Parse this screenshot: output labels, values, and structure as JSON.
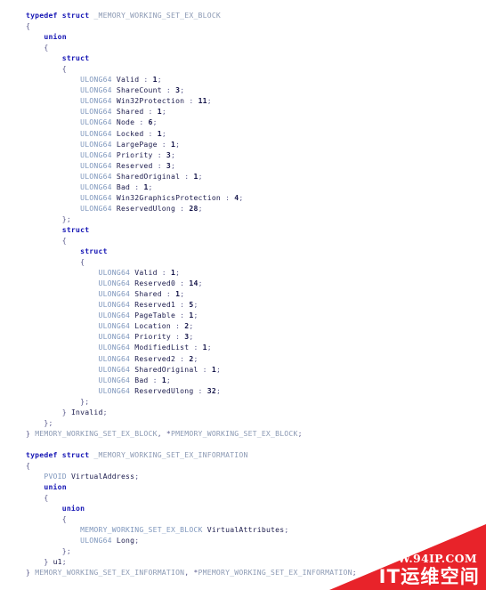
{
  "code": {
    "language": "c",
    "lines": [
      [
        {
          "t": "typedef struct ",
          "c": "kw"
        },
        {
          "t": "_MEMORY_WORKING_SET_EX_BLOCK",
          "c": "tname"
        }
      ],
      [
        {
          "t": "{",
          "c": "punc"
        }
      ],
      [
        {
          "t": "    ",
          "c": "punc"
        },
        {
          "t": "union",
          "c": "kw"
        }
      ],
      [
        {
          "t": "    {",
          "c": "punc"
        }
      ],
      [
        {
          "t": "        ",
          "c": "punc"
        },
        {
          "t": "struct",
          "c": "kw"
        }
      ],
      [
        {
          "t": "        {",
          "c": "punc"
        }
      ],
      [
        {
          "t": "            ",
          "c": "punc"
        },
        {
          "t": "ULONG64",
          "c": "type"
        },
        {
          "t": " ",
          "c": "punc"
        },
        {
          "t": "Valid",
          "c": "ident"
        },
        {
          "t": " : ",
          "c": "punc"
        },
        {
          "t": "1",
          "c": "num"
        },
        {
          "t": ";",
          "c": "punc"
        }
      ],
      [
        {
          "t": "            ",
          "c": "punc"
        },
        {
          "t": "ULONG64",
          "c": "type"
        },
        {
          "t": " ",
          "c": "punc"
        },
        {
          "t": "ShareCount",
          "c": "ident"
        },
        {
          "t": " : ",
          "c": "punc"
        },
        {
          "t": "3",
          "c": "num"
        },
        {
          "t": ";",
          "c": "punc"
        }
      ],
      [
        {
          "t": "            ",
          "c": "punc"
        },
        {
          "t": "ULONG64",
          "c": "type"
        },
        {
          "t": " ",
          "c": "punc"
        },
        {
          "t": "Win32Protection",
          "c": "ident"
        },
        {
          "t": " : ",
          "c": "punc"
        },
        {
          "t": "11",
          "c": "num"
        },
        {
          "t": ";",
          "c": "punc"
        }
      ],
      [
        {
          "t": "            ",
          "c": "punc"
        },
        {
          "t": "ULONG64",
          "c": "type"
        },
        {
          "t": " ",
          "c": "punc"
        },
        {
          "t": "Shared",
          "c": "ident"
        },
        {
          "t": " : ",
          "c": "punc"
        },
        {
          "t": "1",
          "c": "num"
        },
        {
          "t": ";",
          "c": "punc"
        }
      ],
      [
        {
          "t": "            ",
          "c": "punc"
        },
        {
          "t": "ULONG64",
          "c": "type"
        },
        {
          "t": " ",
          "c": "punc"
        },
        {
          "t": "Node",
          "c": "ident"
        },
        {
          "t": " : ",
          "c": "punc"
        },
        {
          "t": "6",
          "c": "num"
        },
        {
          "t": ";",
          "c": "punc"
        }
      ],
      [
        {
          "t": "            ",
          "c": "punc"
        },
        {
          "t": "ULONG64",
          "c": "type"
        },
        {
          "t": " ",
          "c": "punc"
        },
        {
          "t": "Locked",
          "c": "ident"
        },
        {
          "t": " : ",
          "c": "punc"
        },
        {
          "t": "1",
          "c": "num"
        },
        {
          "t": ";",
          "c": "punc"
        }
      ],
      [
        {
          "t": "            ",
          "c": "punc"
        },
        {
          "t": "ULONG64",
          "c": "type"
        },
        {
          "t": " ",
          "c": "punc"
        },
        {
          "t": "LargePage",
          "c": "ident"
        },
        {
          "t": " : ",
          "c": "punc"
        },
        {
          "t": "1",
          "c": "num"
        },
        {
          "t": ";",
          "c": "punc"
        }
      ],
      [
        {
          "t": "            ",
          "c": "punc"
        },
        {
          "t": "ULONG64",
          "c": "type"
        },
        {
          "t": " ",
          "c": "punc"
        },
        {
          "t": "Priority",
          "c": "ident"
        },
        {
          "t": " : ",
          "c": "punc"
        },
        {
          "t": "3",
          "c": "num"
        },
        {
          "t": ";",
          "c": "punc"
        }
      ],
      [
        {
          "t": "            ",
          "c": "punc"
        },
        {
          "t": "ULONG64",
          "c": "type"
        },
        {
          "t": " ",
          "c": "punc"
        },
        {
          "t": "Reserved",
          "c": "ident"
        },
        {
          "t": " : ",
          "c": "punc"
        },
        {
          "t": "3",
          "c": "num"
        },
        {
          "t": ";",
          "c": "punc"
        }
      ],
      [
        {
          "t": "            ",
          "c": "punc"
        },
        {
          "t": "ULONG64",
          "c": "type"
        },
        {
          "t": " ",
          "c": "punc"
        },
        {
          "t": "SharedOriginal",
          "c": "ident"
        },
        {
          "t": " : ",
          "c": "punc"
        },
        {
          "t": "1",
          "c": "num"
        },
        {
          "t": ";",
          "c": "punc"
        }
      ],
      [
        {
          "t": "            ",
          "c": "punc"
        },
        {
          "t": "ULONG64",
          "c": "type"
        },
        {
          "t": " ",
          "c": "punc"
        },
        {
          "t": "Bad",
          "c": "ident"
        },
        {
          "t": " : ",
          "c": "punc"
        },
        {
          "t": "1",
          "c": "num"
        },
        {
          "t": ";",
          "c": "punc"
        }
      ],
      [
        {
          "t": "            ",
          "c": "punc"
        },
        {
          "t": "ULONG64",
          "c": "type"
        },
        {
          "t": " ",
          "c": "punc"
        },
        {
          "t": "Win32GraphicsProtection",
          "c": "ident"
        },
        {
          "t": " : ",
          "c": "punc"
        },
        {
          "t": "4",
          "c": "num"
        },
        {
          "t": ";",
          "c": "punc"
        }
      ],
      [
        {
          "t": "            ",
          "c": "punc"
        },
        {
          "t": "ULONG64",
          "c": "type"
        },
        {
          "t": " ",
          "c": "punc"
        },
        {
          "t": "ReservedUlong",
          "c": "ident"
        },
        {
          "t": " : ",
          "c": "punc"
        },
        {
          "t": "28",
          "c": "num"
        },
        {
          "t": ";",
          "c": "punc"
        }
      ],
      [
        {
          "t": "        };",
          "c": "punc"
        }
      ],
      [
        {
          "t": "        ",
          "c": "punc"
        },
        {
          "t": "struct",
          "c": "kw"
        }
      ],
      [
        {
          "t": "        {",
          "c": "punc"
        }
      ],
      [
        {
          "t": "            ",
          "c": "punc"
        },
        {
          "t": "struct",
          "c": "kw"
        }
      ],
      [
        {
          "t": "            {",
          "c": "punc"
        }
      ],
      [
        {
          "t": "                ",
          "c": "punc"
        },
        {
          "t": "ULONG64",
          "c": "type"
        },
        {
          "t": " ",
          "c": "punc"
        },
        {
          "t": "Valid",
          "c": "ident"
        },
        {
          "t": " : ",
          "c": "punc"
        },
        {
          "t": "1",
          "c": "num"
        },
        {
          "t": ";",
          "c": "punc"
        }
      ],
      [
        {
          "t": "                ",
          "c": "punc"
        },
        {
          "t": "ULONG64",
          "c": "type"
        },
        {
          "t": " ",
          "c": "punc"
        },
        {
          "t": "Reserved0",
          "c": "ident"
        },
        {
          "t": " : ",
          "c": "punc"
        },
        {
          "t": "14",
          "c": "num"
        },
        {
          "t": ";",
          "c": "punc"
        }
      ],
      [
        {
          "t": "                ",
          "c": "punc"
        },
        {
          "t": "ULONG64",
          "c": "type"
        },
        {
          "t": " ",
          "c": "punc"
        },
        {
          "t": "Shared",
          "c": "ident"
        },
        {
          "t": " : ",
          "c": "punc"
        },
        {
          "t": "1",
          "c": "num"
        },
        {
          "t": ";",
          "c": "punc"
        }
      ],
      [
        {
          "t": "                ",
          "c": "punc"
        },
        {
          "t": "ULONG64",
          "c": "type"
        },
        {
          "t": " ",
          "c": "punc"
        },
        {
          "t": "Reserved1",
          "c": "ident"
        },
        {
          "t": " : ",
          "c": "punc"
        },
        {
          "t": "5",
          "c": "num"
        },
        {
          "t": ";",
          "c": "punc"
        }
      ],
      [
        {
          "t": "                ",
          "c": "punc"
        },
        {
          "t": "ULONG64",
          "c": "type"
        },
        {
          "t": " ",
          "c": "punc"
        },
        {
          "t": "PageTable",
          "c": "ident"
        },
        {
          "t": " : ",
          "c": "punc"
        },
        {
          "t": "1",
          "c": "num"
        },
        {
          "t": ";",
          "c": "punc"
        }
      ],
      [
        {
          "t": "                ",
          "c": "punc"
        },
        {
          "t": "ULONG64",
          "c": "type"
        },
        {
          "t": " ",
          "c": "punc"
        },
        {
          "t": "Location",
          "c": "ident"
        },
        {
          "t": " : ",
          "c": "punc"
        },
        {
          "t": "2",
          "c": "num"
        },
        {
          "t": ";",
          "c": "punc"
        }
      ],
      [
        {
          "t": "                ",
          "c": "punc"
        },
        {
          "t": "ULONG64",
          "c": "type"
        },
        {
          "t": " ",
          "c": "punc"
        },
        {
          "t": "Priority",
          "c": "ident"
        },
        {
          "t": " : ",
          "c": "punc"
        },
        {
          "t": "3",
          "c": "num"
        },
        {
          "t": ";",
          "c": "punc"
        }
      ],
      [
        {
          "t": "                ",
          "c": "punc"
        },
        {
          "t": "ULONG64",
          "c": "type"
        },
        {
          "t": " ",
          "c": "punc"
        },
        {
          "t": "ModifiedList",
          "c": "ident"
        },
        {
          "t": " : ",
          "c": "punc"
        },
        {
          "t": "1",
          "c": "num"
        },
        {
          "t": ";",
          "c": "punc"
        }
      ],
      [
        {
          "t": "                ",
          "c": "punc"
        },
        {
          "t": "ULONG64",
          "c": "type"
        },
        {
          "t": " ",
          "c": "punc"
        },
        {
          "t": "Reserved2",
          "c": "ident"
        },
        {
          "t": " : ",
          "c": "punc"
        },
        {
          "t": "2",
          "c": "num"
        },
        {
          "t": ";",
          "c": "punc"
        }
      ],
      [
        {
          "t": "                ",
          "c": "punc"
        },
        {
          "t": "ULONG64",
          "c": "type"
        },
        {
          "t": " ",
          "c": "punc"
        },
        {
          "t": "SharedOriginal",
          "c": "ident"
        },
        {
          "t": " : ",
          "c": "punc"
        },
        {
          "t": "1",
          "c": "num"
        },
        {
          "t": ";",
          "c": "punc"
        }
      ],
      [
        {
          "t": "                ",
          "c": "punc"
        },
        {
          "t": "ULONG64",
          "c": "type"
        },
        {
          "t": " ",
          "c": "punc"
        },
        {
          "t": "Bad",
          "c": "ident"
        },
        {
          "t": " : ",
          "c": "punc"
        },
        {
          "t": "1",
          "c": "num"
        },
        {
          "t": ";",
          "c": "punc"
        }
      ],
      [
        {
          "t": "                ",
          "c": "punc"
        },
        {
          "t": "ULONG64",
          "c": "type"
        },
        {
          "t": " ",
          "c": "punc"
        },
        {
          "t": "ReservedUlong",
          "c": "ident"
        },
        {
          "t": " : ",
          "c": "punc"
        },
        {
          "t": "32",
          "c": "num"
        },
        {
          "t": ";",
          "c": "punc"
        }
      ],
      [
        {
          "t": "            };",
          "c": "punc"
        }
      ],
      [
        {
          "t": "        } ",
          "c": "punc"
        },
        {
          "t": "Invalid",
          "c": "ident"
        },
        {
          "t": ";",
          "c": "punc"
        }
      ],
      [
        {
          "t": "    };",
          "c": "punc"
        }
      ],
      [
        {
          "t": "} ",
          "c": "punc"
        },
        {
          "t": "MEMORY_WORKING_SET_EX_BLOCK",
          "c": "tname"
        },
        {
          "t": ", ",
          "c": "punc"
        },
        {
          "t": "*",
          "c": "punc"
        },
        {
          "t": "PMEMORY_WORKING_SET_EX_BLOCK",
          "c": "tname"
        },
        {
          "t": ";",
          "c": "punc"
        }
      ],
      [
        {
          "t": " ",
          "c": "punc"
        }
      ],
      [
        {
          "t": "typedef struct ",
          "c": "kw"
        },
        {
          "t": "_MEMORY_WORKING_SET_EX_INFORMATION",
          "c": "tname"
        }
      ],
      [
        {
          "t": "{",
          "c": "punc"
        }
      ],
      [
        {
          "t": "    ",
          "c": "punc"
        },
        {
          "t": "PVOID",
          "c": "type"
        },
        {
          "t": " ",
          "c": "punc"
        },
        {
          "t": "VirtualAddress",
          "c": "ident"
        },
        {
          "t": ";",
          "c": "punc"
        }
      ],
      [
        {
          "t": "    ",
          "c": "punc"
        },
        {
          "t": "union",
          "c": "kw"
        }
      ],
      [
        {
          "t": "    {",
          "c": "punc"
        }
      ],
      [
        {
          "t": "        ",
          "c": "punc"
        },
        {
          "t": "union",
          "c": "kw"
        }
      ],
      [
        {
          "t": "        {",
          "c": "punc"
        }
      ],
      [
        {
          "t": "            ",
          "c": "punc"
        },
        {
          "t": "MEMORY_WORKING_SET_EX_BLOCK",
          "c": "type"
        },
        {
          "t": " ",
          "c": "punc"
        },
        {
          "t": "VirtualAttributes",
          "c": "ident"
        },
        {
          "t": ";",
          "c": "punc"
        }
      ],
      [
        {
          "t": "            ",
          "c": "punc"
        },
        {
          "t": "ULONG64",
          "c": "type"
        },
        {
          "t": " ",
          "c": "punc"
        },
        {
          "t": "Long",
          "c": "ident"
        },
        {
          "t": ";",
          "c": "punc"
        }
      ],
      [
        {
          "t": "        };",
          "c": "punc"
        }
      ],
      [
        {
          "t": "    } ",
          "c": "punc"
        },
        {
          "t": "u1",
          "c": "ident"
        },
        {
          "t": ";",
          "c": "punc"
        }
      ],
      [
        {
          "t": "} ",
          "c": "punc"
        },
        {
          "t": "MEMORY_WORKING_SET_EX_INFORMATION",
          "c": "tname"
        },
        {
          "t": ", ",
          "c": "punc"
        },
        {
          "t": "*",
          "c": "punc"
        },
        {
          "t": "PMEMORY_WORKING_SET_EX_INFORMATION",
          "c": "tname"
        },
        {
          "t": ";",
          "c": "punc"
        }
      ]
    ]
  },
  "watermark": {
    "url": "WWW.94IP.COM",
    "brand": "IT运维空间",
    "color": "#e8232a"
  },
  "colors": {
    "background": "#ffffff",
    "keyword": "#1414b4",
    "type_name": "#8c9ab4",
    "type": "#7f97bd",
    "identifier": "#1d1d4e",
    "punctuation": "#5a5a8c",
    "number": "#16164a"
  }
}
